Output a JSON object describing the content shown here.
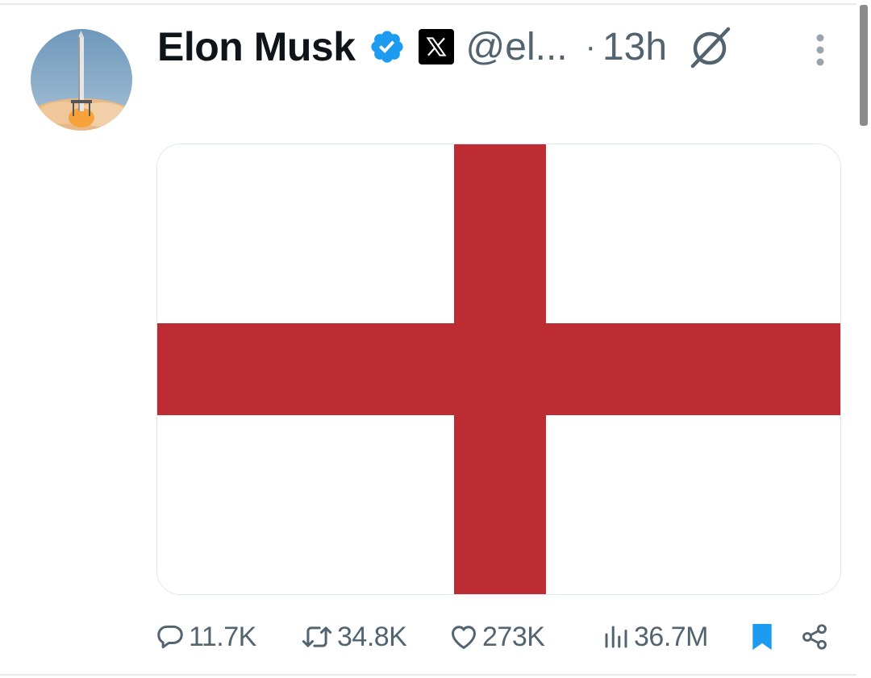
{
  "tweet": {
    "author_name": "Elon Musk",
    "handle": "@el...",
    "separator": "·",
    "time": "13h"
  },
  "actions": {
    "replies": "11.7K",
    "reposts": "34.8K",
    "likes": "273K",
    "views": "36.7M"
  },
  "colors": {
    "verified_blue": "#1d9bf0",
    "bookmark_blue": "#1d9bf0",
    "cross_red": "#bc2c32",
    "secondary_text": "#536471",
    "primary_text": "#0f1419"
  },
  "icons": {
    "verified": "verified-badge-icon",
    "affiliation": "x-logo-icon",
    "grok": "grok-icon",
    "more": "more-vertical-icon",
    "reply": "reply-icon",
    "repost": "repost-icon",
    "like": "heart-icon",
    "views": "views-icon",
    "bookmark": "bookmark-icon",
    "share": "share-icon"
  }
}
